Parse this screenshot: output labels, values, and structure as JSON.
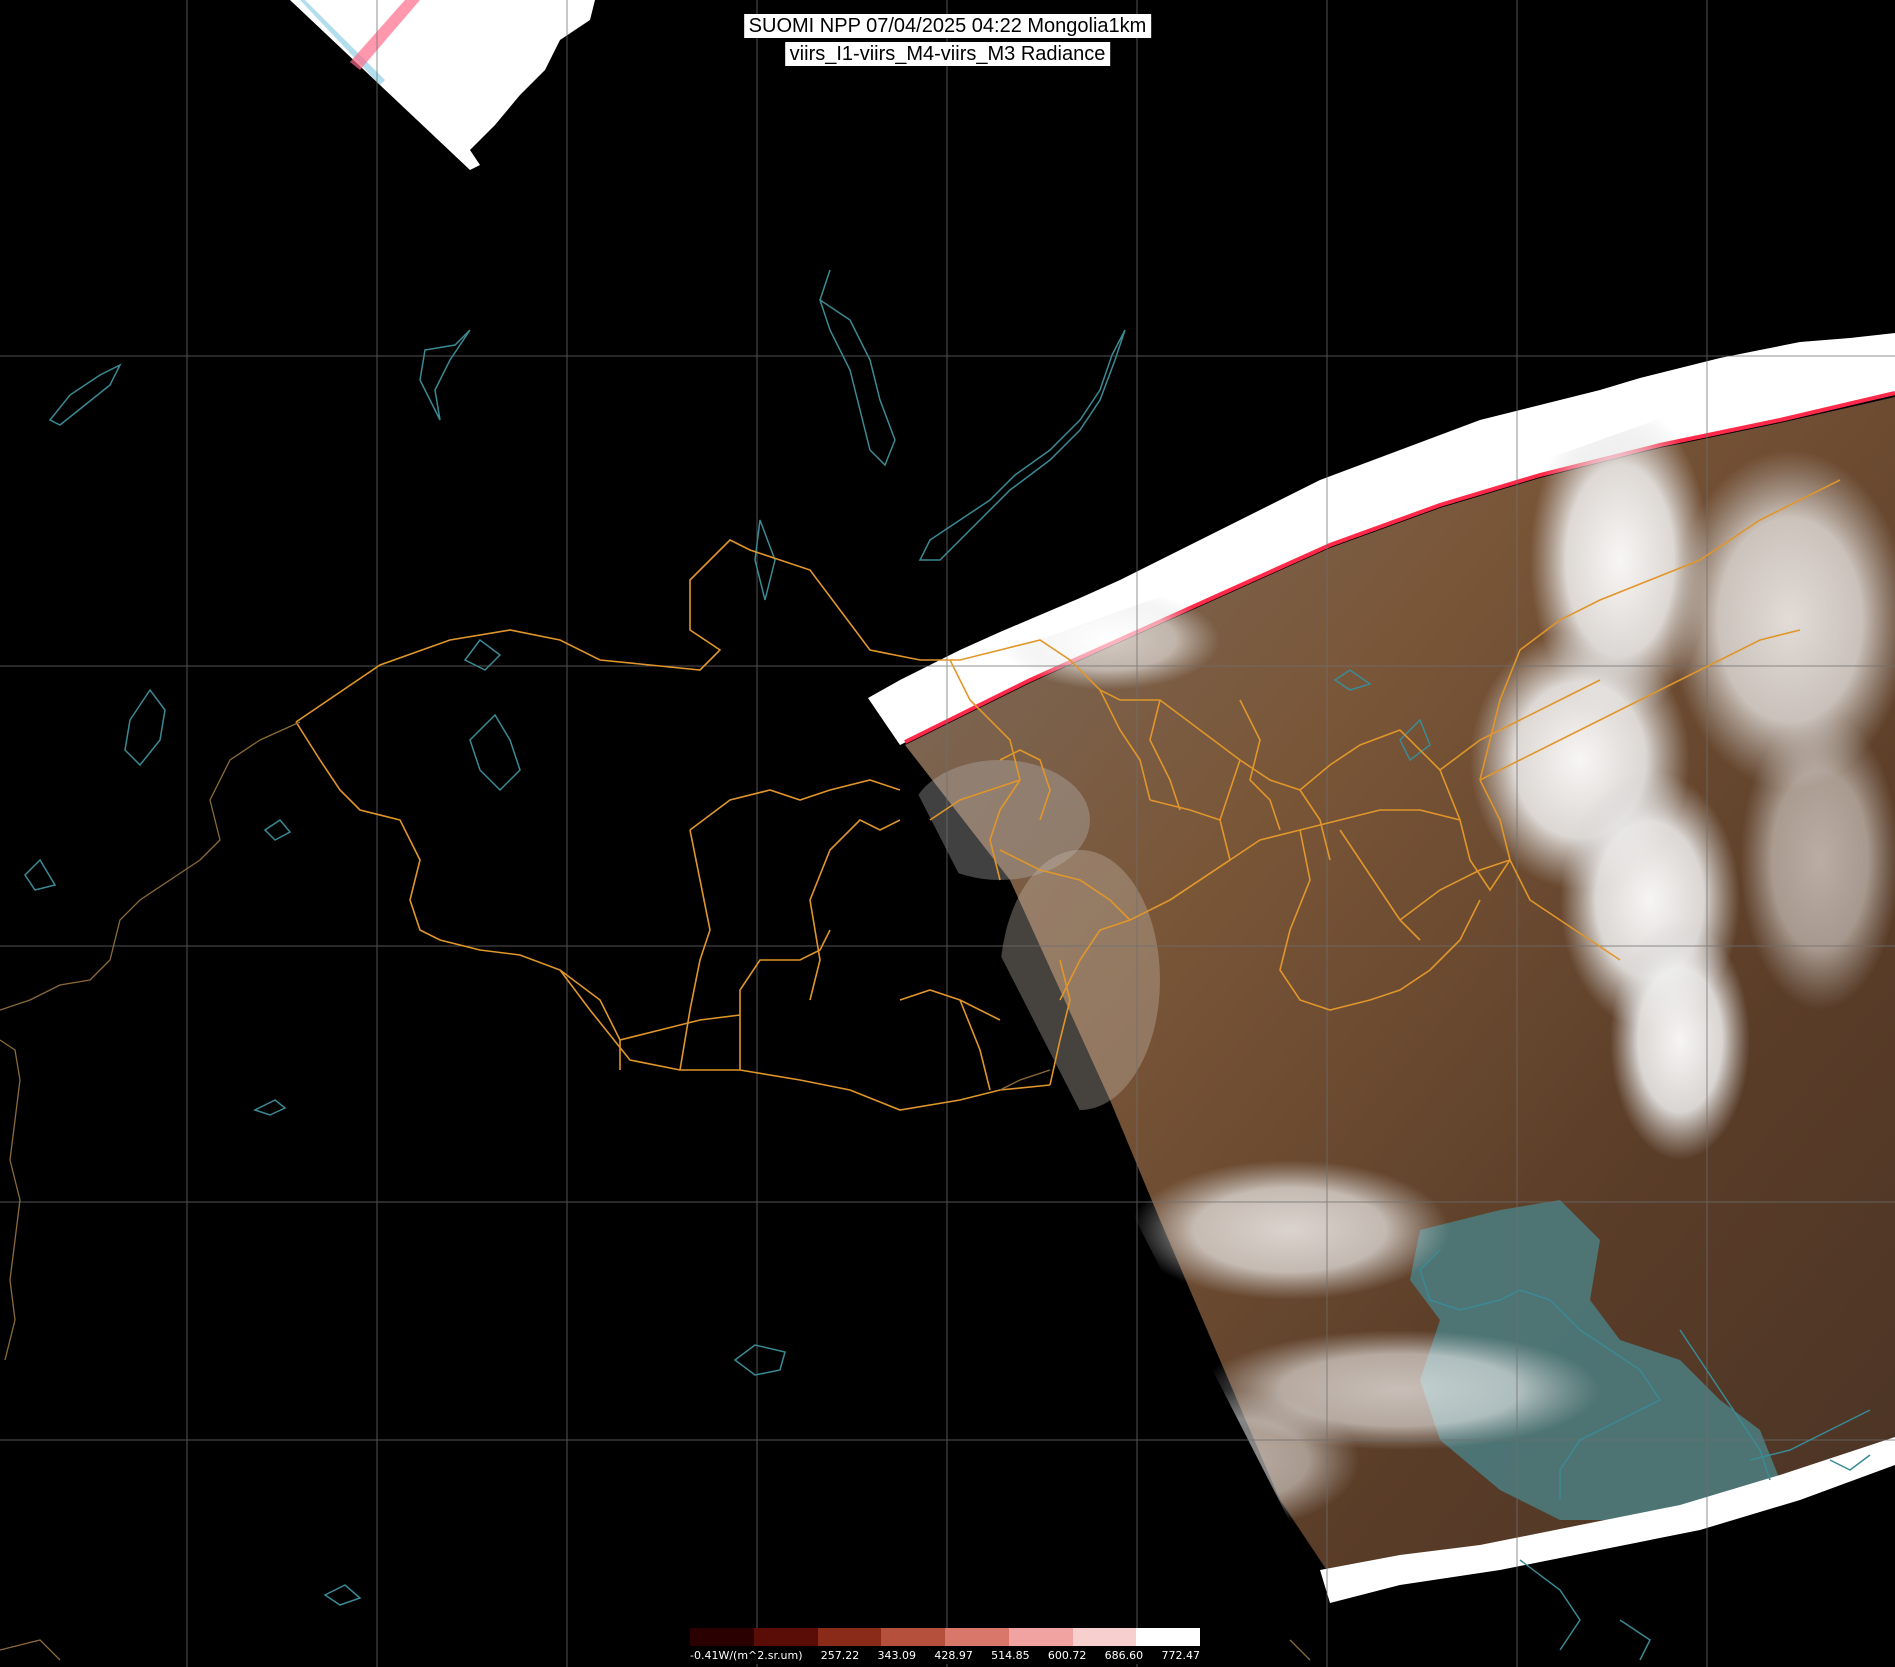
{
  "title": {
    "line1": "SUOMI NPP 07/04/2025 04:22 Mongolia1km",
    "line2": "viirs_I1-viirs_M4-viirs_M3 Radiance"
  },
  "colorbar": {
    "labels": [
      "-0.41W/(m^2.sr.um)",
      "257.22",
      "343.09",
      "428.97",
      "514.85",
      "600.72",
      "686.60",
      "772.47"
    ],
    "colors": [
      "#2a0000",
      "#5a0d06",
      "#8a2a18",
      "#b5503c",
      "#d9776a",
      "#f0a3a0",
      "#f8cfcf",
      "#ffffff"
    ]
  },
  "colors": {
    "background": "#000000",
    "graticule": "#6e6e6e",
    "border": "#e0962a",
    "coastline": "#3b8a95",
    "swath_edge": "#ff2a4a",
    "land": "#6b4a30",
    "sea": "#4f7a7a",
    "cloud": "#f2f2f2"
  }
}
